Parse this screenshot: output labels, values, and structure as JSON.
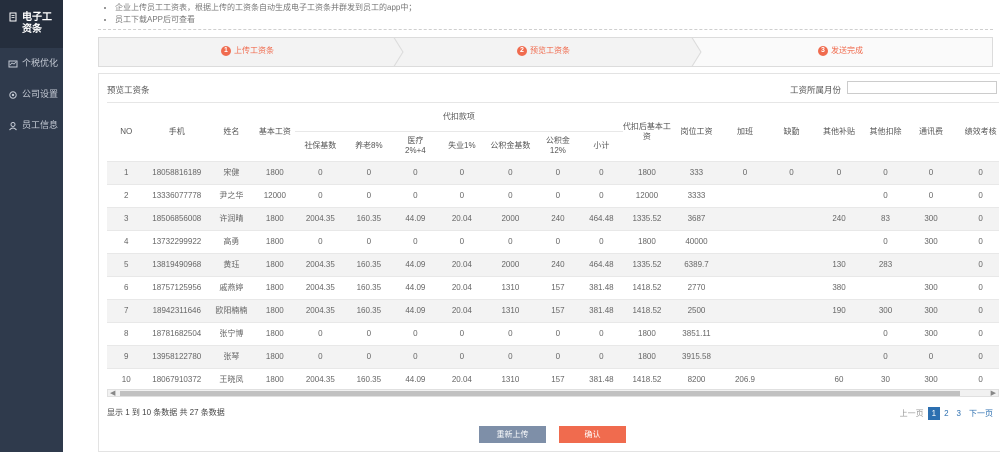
{
  "sidebar": {
    "items": [
      {
        "label": "电子工资条",
        "icon": "receipt-icon",
        "active": true
      },
      {
        "label": "个税优化",
        "icon": "chart-icon",
        "active": false
      },
      {
        "label": "公司设置",
        "icon": "gear-icon",
        "active": false
      },
      {
        "label": "员工信息",
        "icon": "user-icon",
        "active": false
      }
    ]
  },
  "tips": [
    "企业上传员工工资表，根据上传的工资条自动生成电子工资条并群发到员工的app中；",
    "员工下载APP后可查看"
  ],
  "steps": [
    {
      "num": "1",
      "label": "上传工资条"
    },
    {
      "num": "2",
      "label": "预览工资条"
    },
    {
      "num": "3",
      "label": "发送完成"
    }
  ],
  "panel": {
    "title": "预览工资条",
    "month_label": "工资所属月份",
    "month_value": ""
  },
  "table": {
    "headers": {
      "no": "NO",
      "phone": "手机",
      "name": "姓名",
      "base": "基本工资",
      "group": "代扣款项",
      "sub": [
        "社保基数",
        "养老8%",
        "医疗\n2%+4",
        "失业1%",
        "公积金基数",
        "公积金\n12%",
        "小计"
      ],
      "after": "代扣后基本工资",
      "post": "岗位工资",
      "overtime": "加班",
      "absence": "缺勤",
      "allowance": "其他补贴",
      "deduction": "其他扣除",
      "comm": "通讯费",
      "perf": "绩效考核"
    },
    "rows": [
      [
        "1",
        "18058816189",
        "宋健",
        "1800",
        "0",
        "0",
        "0",
        "0",
        "0",
        "0",
        "0",
        "1800",
        "333",
        "0",
        "0",
        "0",
        "0",
        "0",
        "0"
      ],
      [
        "2",
        "13336077778",
        "尹之华",
        "12000",
        "0",
        "0",
        "0",
        "0",
        "0",
        "0",
        "0",
        "12000",
        "3333",
        "",
        "",
        "",
        "0",
        "0",
        "0"
      ],
      [
        "3",
        "18506856008",
        "许润晴",
        "1800",
        "2004.35",
        "160.35",
        "44.09",
        "20.04",
        "2000",
        "240",
        "464.48",
        "1335.52",
        "3687",
        "",
        "",
        "240",
        "83",
        "300",
        "0"
      ],
      [
        "4",
        "13732299922",
        "高勇",
        "1800",
        "0",
        "0",
        "0",
        "0",
        "0",
        "0",
        "0",
        "1800",
        "40000",
        "",
        "",
        "",
        "0",
        "300",
        "0"
      ],
      [
        "5",
        "13819490968",
        "黄珏",
        "1800",
        "2004.35",
        "160.35",
        "44.09",
        "20.04",
        "2000",
        "240",
        "464.48",
        "1335.52",
        "6389.7",
        "",
        "",
        "130",
        "283",
        "",
        "0"
      ],
      [
        "6",
        "18757125956",
        "戚燕婷",
        "1800",
        "2004.35",
        "160.35",
        "44.09",
        "20.04",
        "1310",
        "157",
        "381.48",
        "1418.52",
        "2770",
        "",
        "",
        "380",
        "",
        "300",
        "0"
      ],
      [
        "7",
        "18942311646",
        "欧阳楠楠",
        "1800",
        "2004.35",
        "160.35",
        "44.09",
        "20.04",
        "1310",
        "157",
        "381.48",
        "1418.52",
        "2500",
        "",
        "",
        "190",
        "300",
        "300",
        "0"
      ],
      [
        "8",
        "18781682504",
        "张宁博",
        "1800",
        "0",
        "0",
        "0",
        "0",
        "0",
        "0",
        "0",
        "1800",
        "3851.11",
        "",
        "",
        "",
        "0",
        "300",
        "0"
      ],
      [
        "9",
        "13958122780",
        "张琴",
        "1800",
        "0",
        "0",
        "0",
        "0",
        "0",
        "0",
        "0",
        "1800",
        "3915.58",
        "",
        "",
        "",
        "0",
        "0",
        "0"
      ],
      [
        "10",
        "18067910372",
        "王晓凤",
        "1800",
        "2004.35",
        "160.35",
        "44.09",
        "20.04",
        "1310",
        "157",
        "381.48",
        "1418.52",
        "8200",
        "206.9",
        "",
        "60",
        "30",
        "300",
        "0"
      ]
    ]
  },
  "footer": {
    "info": "显示 1 到 10 条数据 共 27 条数据",
    "pager": {
      "prev": "上一页",
      "pages": [
        "1",
        "2",
        "3"
      ],
      "current": "1",
      "next": "下一页"
    }
  },
  "buttons": {
    "reupload": "重新上传",
    "confirm": "确认"
  },
  "colors": {
    "sidebar_bg": "#2f3a4c",
    "accent_orange": "#f06b4e",
    "button_gray": "#7e8fa8",
    "link_blue": "#2c6fb0"
  }
}
